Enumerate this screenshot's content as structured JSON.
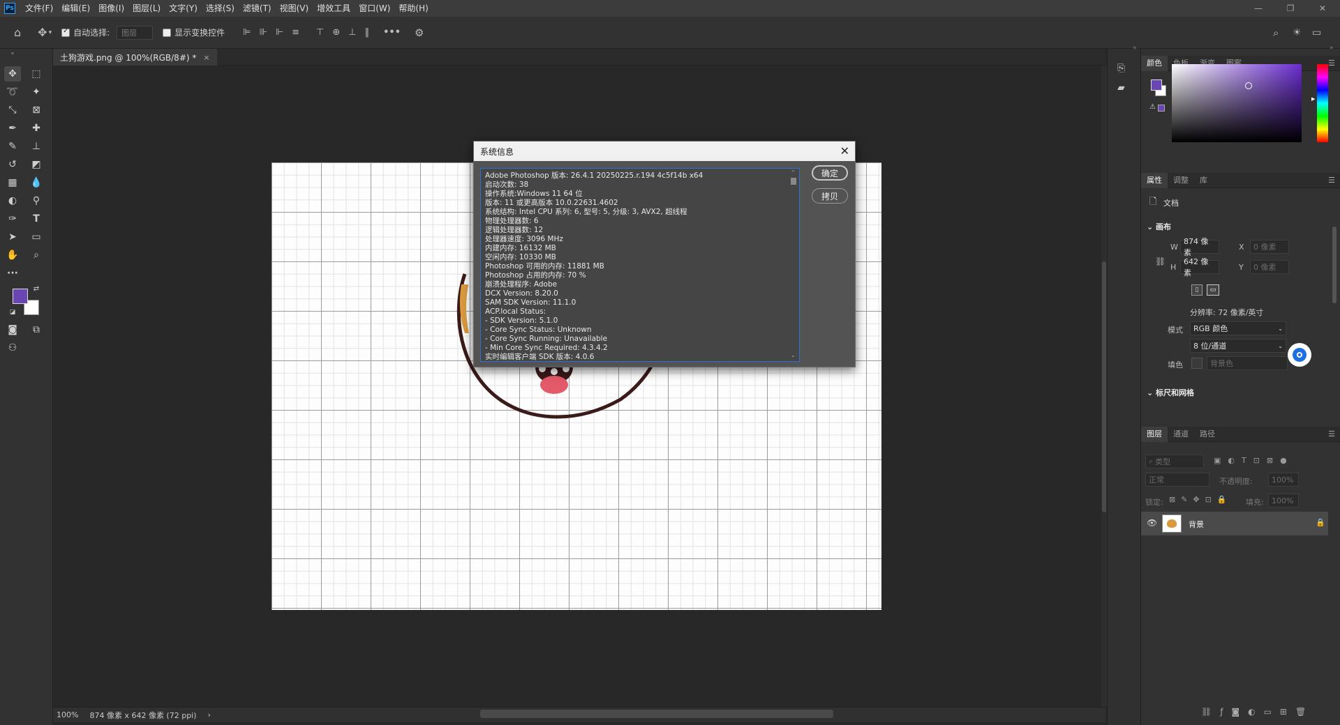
{
  "menubar": {
    "logo": "Ps",
    "items": [
      "文件(F)",
      "编辑(E)",
      "图像(I)",
      "图层(L)",
      "文字(Y)",
      "选择(S)",
      "滤镜(T)",
      "视图(V)",
      "增效工具",
      "窗口(W)",
      "帮助(H)"
    ]
  },
  "options": {
    "auto_select_label": "自动选择:",
    "auto_select_value": "图层",
    "show_transform_label": "显示变换控件",
    "more": "•••"
  },
  "tab": {
    "title": "土狗游戏.png @ 100%(RGB/8#) *",
    "close": "×"
  },
  "status": {
    "zoom": "100%",
    "doc_info": "874 像素 x 642 像素 (72 ppi)",
    "arrow": "›"
  },
  "dialog": {
    "title": "系统信息",
    "close": "✕",
    "ok_label": "确定",
    "copy_label": "拷贝",
    "lines": [
      "Adobe Photoshop 版本: 26.4.1 20250225.r.194 4c5f14b  x64",
      "启动次数: 38",
      "操作系统:Windows 11 64 位",
      "版本: 11 或更高版本 10.0.22631.4602",
      "系统结构: Intel CPU 系列: 6, 型号: 5, 分级: 3, AVX2, 超线程",
      "物理处理器数: 6",
      "逻辑处理器数: 12",
      "处理器速度: 3096 MHz",
      "内建内存: 16132 MB",
      "空闲内存: 10330 MB",
      "Photoshop 可用的内存: 11881 MB",
      "Photoshop 占用的内存: 70 %",
      "崩溃处理程序: Adobe",
      "DCX Version: 8.20.0",
      "SAM SDK Version: 11.1.0",
      "ACP.local Status:",
      " - SDK Version: 5.1.0",
      " - Core Sync Status: Unknown",
      " - Core Sync Running: Unavailable",
      " - Min Core Sync Required: 4.3.4.2",
      "实时编辑客户端 SDK 版本: 4.0.6"
    ]
  },
  "color_panel": {
    "tabs": [
      "颜色",
      "色板",
      "渐变",
      "图案"
    ],
    "foreground": "#6a46b4",
    "background": "#ffffff"
  },
  "properties_panel": {
    "tabs": [
      "属性",
      "调整",
      "库"
    ],
    "doc_label": "文档",
    "canvas_section": "画布",
    "w_label": "W",
    "w_value": "874 像素",
    "h_label": "H",
    "h_value": "642 像素",
    "x_label": "X",
    "x_placeholder": "0 像素",
    "y_label": "Y",
    "y_placeholder": "0 像素",
    "resolution": "分辨率: 72 像素/英寸",
    "mode_label": "模式",
    "mode_value": "RGB 颜色",
    "depth_value": "8 位/通道",
    "fill_label": "填色",
    "fill_value": "背景色",
    "rulers_section": "标尺和网格"
  },
  "layers_panel": {
    "tabs": [
      "图层",
      "通道",
      "路径"
    ],
    "search_placeholder": "类型",
    "blend_mode": "正常",
    "opacity_label": "不透明度:",
    "opacity_value": "100%",
    "lock_label": "锁定:",
    "fill_label": "填充:",
    "fill_value": "100%",
    "layer_name": "背景"
  }
}
